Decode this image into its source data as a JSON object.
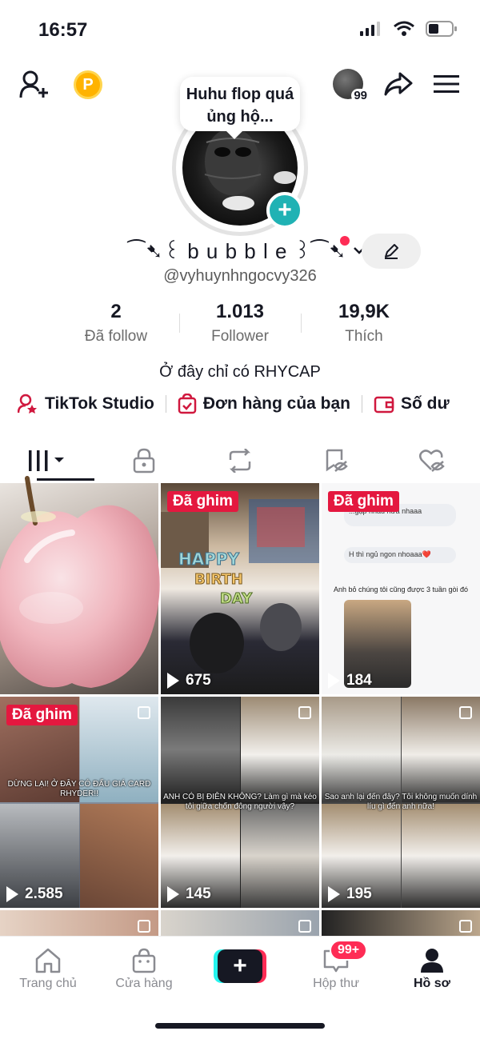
{
  "status_bar": {
    "time": "16:57"
  },
  "note_bubble": {
    "text": "Huhu flop quá ủng hộ..."
  },
  "coin": {
    "label": "P"
  },
  "friends": {
    "count": "99"
  },
  "profile": {
    "display_name": "⁀➷꒰ b u b b l e ꒱⁀➷",
    "username": "@vyhuynhngocvy326",
    "bio": "Ở đây chỉ có RHYCAP"
  },
  "stats": [
    {
      "value": "2",
      "label": "Đã follow"
    },
    {
      "value": "1.013",
      "label": "Follower"
    },
    {
      "value": "19,9K",
      "label": "Thích"
    }
  ],
  "links": {
    "studio": "TikTok Studio",
    "orders": "Đơn hàng của bạn",
    "balance": "Số dư"
  },
  "grid": {
    "pinned_label": "Đã ghim",
    "videos": [
      {
        "views": ""
      },
      {
        "views": "675",
        "overlay": "HAPPY BIRTHDAY"
      },
      {
        "views": "184",
        "chat1": "...gặp nhau nữa nhaaa",
        "chat2": "H thì ngủ ngon nhoaaa❤️",
        "caption": "Anh bỏ chúng tôi cũng được 3 tuần gòi đó"
      },
      {
        "views": "2.585",
        "caption": "DỪNG LẠI! Ở ĐÂY CÓ ĐẤU GIÁ CARD RHYDER!!"
      },
      {
        "views": "145",
        "caption": "ANH CÓ BỊ ĐIÊN KHÔNG? Làm gì mà kéo tôi giữa chốn đông người vậy?"
      },
      {
        "views": "195",
        "caption": "Sao anh lại đến đây? Tôi không muốn dính líu gì đến anh nữa!"
      }
    ]
  },
  "bottom_nav": {
    "home": "Trang chủ",
    "shop": "Cửa hàng",
    "inbox": "Hộp thư",
    "inbox_badge": "99+",
    "profile": "Hồ sơ"
  },
  "colors": {
    "accent": "#fe2c55",
    "teal": "#20b2b4",
    "pin": "#e4183f"
  }
}
